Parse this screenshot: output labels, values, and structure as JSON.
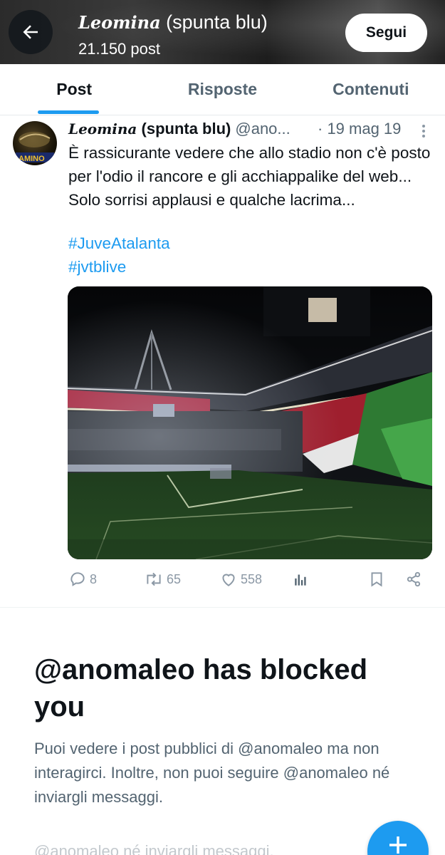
{
  "header": {
    "title_script": "Leomina",
    "title_rest": " (spunta blu)",
    "post_count": "21.150 post",
    "follow_label": "Segui"
  },
  "tabs": [
    {
      "label": "Post",
      "active": true
    },
    {
      "label": "Risposte",
      "active": false
    },
    {
      "label": "Contenuti",
      "active": false
    }
  ],
  "tweet": {
    "author_script": "Leomina",
    "author_rest": " (spunta blu)",
    "handle": "@ano...",
    "date": "· 19 mag 19",
    "text": "È rassicurante vedere che allo stadio non c'è posto per l'odio il rancore e gli acchiappalike del web... Solo sorrisi applausi e qualche lacrima...",
    "hashtags": [
      "#JuveAtalanta",
      "#jvtblive"
    ],
    "counts": {
      "replies": "8",
      "retweets": "65",
      "likes": "558"
    }
  },
  "blocked": {
    "title": "@anomaleo has blocked you",
    "description": "Puoi vedere i post pubblici di @anomaleo ma non interagirci. Inoltre, non puoi seguire @anomaleo né inviargli messaggi.",
    "ghost_line": "@anomaleo né inviargli messaggi."
  },
  "colors": {
    "accent": "#1d9bf0",
    "text": "#0f1419",
    "muted": "#536471"
  },
  "icons": [
    "back-arrow-icon",
    "more-vertical-icon",
    "reply-icon",
    "retweet-icon",
    "like-icon",
    "views-icon",
    "bookmark-icon",
    "share-icon",
    "compose-plus-icon"
  ]
}
